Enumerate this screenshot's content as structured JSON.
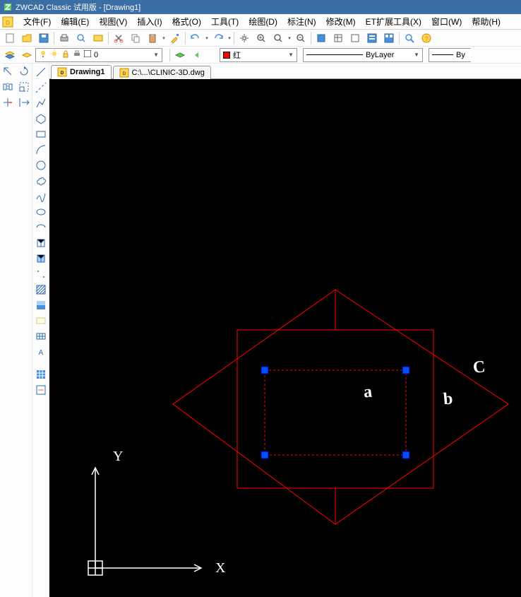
{
  "title": "ZWCAD Classic 试用版 - [Drawing1]",
  "menus": [
    "文件(F)",
    "编辑(E)",
    "视图(V)",
    "插入(I)",
    "格式(O)",
    "工具(T)",
    "绘图(D)",
    "标注(N)",
    "修改(M)",
    "ET扩展工具(X)",
    "窗口(W)",
    "帮助(H)"
  ],
  "tabs": [
    {
      "label": "Drawing1",
      "active": true
    },
    {
      "label": "C:\\...\\CLINIC-3D.dwg",
      "active": false
    }
  ],
  "props": {
    "layer_prefix": "0",
    "color_label": "红",
    "linetype": "ByLayer",
    "lineweight_prefix": "By"
  },
  "annotations": {
    "a": "a",
    "b": "b",
    "c": "C"
  },
  "axes": {
    "x": "X",
    "y": "Y"
  }
}
